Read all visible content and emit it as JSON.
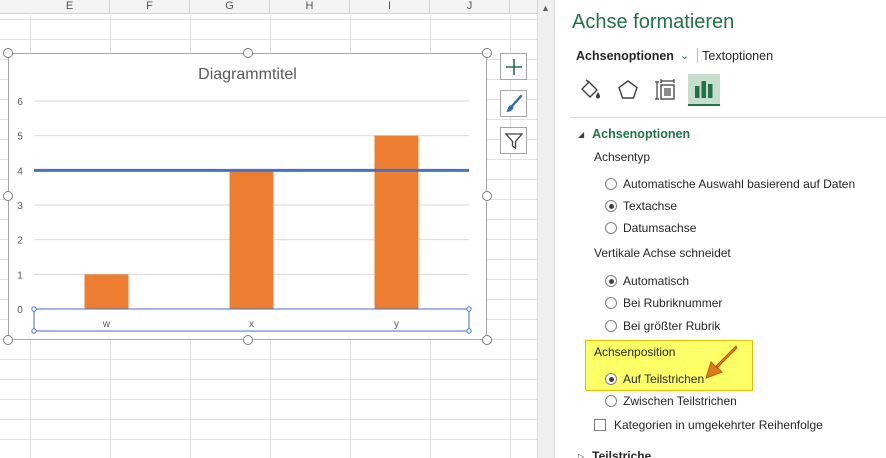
{
  "sheet": {
    "columns": [
      "E",
      "F",
      "G",
      "H",
      "I",
      "J"
    ]
  },
  "chart": {
    "buttons": [
      "chart-elements-icon",
      "chart-styles-icon",
      "chart-filter-icon"
    ]
  },
  "chart_data": {
    "type": "bar",
    "title": "Diagrammtitel",
    "categories": [
      "w",
      "x",
      "y"
    ],
    "values": [
      1,
      4,
      5
    ],
    "ylim": [
      0,
      6
    ],
    "yticks": [
      "0",
      "1",
      "2",
      "3",
      "4",
      "5",
      "6"
    ],
    "reference_line": 4,
    "bar_color": "#ed7d31",
    "line_color": "#4472c4",
    "grid": true
  },
  "pane": {
    "title": "Achse formatieren",
    "tab_axis": "Achsenoptionen",
    "tab_text": "Textoptionen",
    "icons": [
      "fill-line-icon",
      "effects-icon",
      "size-properties-icon",
      "axis-options-icon"
    ],
    "section": "Achsenoptionen",
    "axis_type_label": "Achsentyp",
    "axis_type_options": [
      "Automatische Auswahl basierend auf Daten",
      "Textachse",
      "Datumsachse"
    ],
    "crosses_label": "Vertikale Achse schneidet",
    "crosses_options": [
      "Automatisch",
      "Bei Rubriknummer",
      "Bei größter Rubrik"
    ],
    "position_label": "Achsenposition",
    "position_options": [
      "Auf Teilstrichen",
      "Zwischen Teilstrichen"
    ],
    "reverse_label": "Kategorien in umgekehrter Reihenfolge",
    "next_section": "Teilstriche",
    "accent": "#217346",
    "highlight_color": "#ffff66",
    "arrow_color": "#e07b1a"
  }
}
